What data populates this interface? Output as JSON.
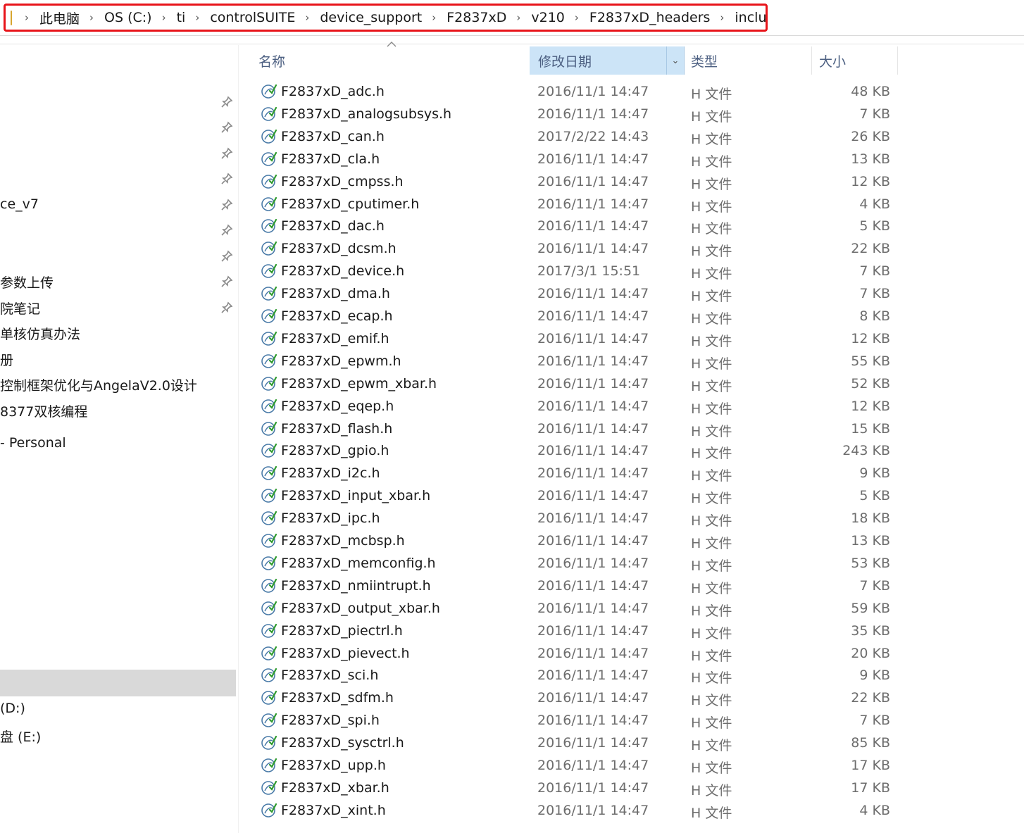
{
  "address_bar": {
    "crumbs": [
      "此电脑",
      "OS (C:)",
      "ti",
      "controlSUITE",
      "device_support",
      "F2837xD",
      "v210",
      "F2837xD_headers",
      "include"
    ],
    "highlight_color": "#e8141a"
  },
  "nav": {
    "items": [
      {
        "label": "ce_v7"
      },
      {
        "label": "参数上传"
      },
      {
        "label": "院笔记"
      },
      {
        "label": "单核仿真办法"
      },
      {
        "label": "册"
      },
      {
        "label": "控制框架优化与AngelaV2.0设计"
      },
      {
        "label": "8377双核编程"
      },
      {
        "label": "- Personal"
      },
      {
        "label": "(D:)"
      },
      {
        "label": "盘 (E:)"
      }
    ]
  },
  "columns": {
    "name": "名称",
    "date": "修改日期",
    "type": "类型",
    "size": "大小"
  },
  "files": [
    {
      "name": "F2837xD_adc.h",
      "date": "2016/11/1 14:47",
      "type": "H 文件",
      "size": "48 KB"
    },
    {
      "name": "F2837xD_analogsubsys.h",
      "date": "2016/11/1 14:47",
      "type": "H 文件",
      "size": "7 KB"
    },
    {
      "name": "F2837xD_can.h",
      "date": "2017/2/22 14:43",
      "type": "H 文件",
      "size": "26 KB"
    },
    {
      "name": "F2837xD_cla.h",
      "date": "2016/11/1 14:47",
      "type": "H 文件",
      "size": "13 KB"
    },
    {
      "name": "F2837xD_cmpss.h",
      "date": "2016/11/1 14:47",
      "type": "H 文件",
      "size": "12 KB"
    },
    {
      "name": "F2837xD_cputimer.h",
      "date": "2016/11/1 14:47",
      "type": "H 文件",
      "size": "4 KB"
    },
    {
      "name": "F2837xD_dac.h",
      "date": "2016/11/1 14:47",
      "type": "H 文件",
      "size": "5 KB"
    },
    {
      "name": "F2837xD_dcsm.h",
      "date": "2016/11/1 14:47",
      "type": "H 文件",
      "size": "22 KB"
    },
    {
      "name": "F2837xD_device.h",
      "date": "2017/3/1 15:51",
      "type": "H 文件",
      "size": "7 KB"
    },
    {
      "name": "F2837xD_dma.h",
      "date": "2016/11/1 14:47",
      "type": "H 文件",
      "size": "7 KB"
    },
    {
      "name": "F2837xD_ecap.h",
      "date": "2016/11/1 14:47",
      "type": "H 文件",
      "size": "8 KB"
    },
    {
      "name": "F2837xD_emif.h",
      "date": "2016/11/1 14:47",
      "type": "H 文件",
      "size": "12 KB"
    },
    {
      "name": "F2837xD_epwm.h",
      "date": "2016/11/1 14:47",
      "type": "H 文件",
      "size": "55 KB"
    },
    {
      "name": "F2837xD_epwm_xbar.h",
      "date": "2016/11/1 14:47",
      "type": "H 文件",
      "size": "52 KB"
    },
    {
      "name": "F2837xD_eqep.h",
      "date": "2016/11/1 14:47",
      "type": "H 文件",
      "size": "12 KB"
    },
    {
      "name": "F2837xD_flash.h",
      "date": "2016/11/1 14:47",
      "type": "H 文件",
      "size": "15 KB"
    },
    {
      "name": "F2837xD_gpio.h",
      "date": "2016/11/1 14:47",
      "type": "H 文件",
      "size": "243 KB"
    },
    {
      "name": "F2837xD_i2c.h",
      "date": "2016/11/1 14:47",
      "type": "H 文件",
      "size": "9 KB"
    },
    {
      "name": "F2837xD_input_xbar.h",
      "date": "2016/11/1 14:47",
      "type": "H 文件",
      "size": "5 KB"
    },
    {
      "name": "F2837xD_ipc.h",
      "date": "2016/11/1 14:47",
      "type": "H 文件",
      "size": "18 KB"
    },
    {
      "name": "F2837xD_mcbsp.h",
      "date": "2016/11/1 14:47",
      "type": "H 文件",
      "size": "13 KB"
    },
    {
      "name": "F2837xD_memconfig.h",
      "date": "2016/11/1 14:47",
      "type": "H 文件",
      "size": "53 KB"
    },
    {
      "name": "F2837xD_nmiintrupt.h",
      "date": "2016/11/1 14:47",
      "type": "H 文件",
      "size": "7 KB"
    },
    {
      "name": "F2837xD_output_xbar.h",
      "date": "2016/11/1 14:47",
      "type": "H 文件",
      "size": "59 KB"
    },
    {
      "name": "F2837xD_piectrl.h",
      "date": "2016/11/1 14:47",
      "type": "H 文件",
      "size": "35 KB"
    },
    {
      "name": "F2837xD_pievect.h",
      "date": "2016/11/1 14:47",
      "type": "H 文件",
      "size": "20 KB"
    },
    {
      "name": "F2837xD_sci.h",
      "date": "2016/11/1 14:47",
      "type": "H 文件",
      "size": "9 KB"
    },
    {
      "name": "F2837xD_sdfm.h",
      "date": "2016/11/1 14:47",
      "type": "H 文件",
      "size": "22 KB"
    },
    {
      "name": "F2837xD_spi.h",
      "date": "2016/11/1 14:47",
      "type": "H 文件",
      "size": "7 KB"
    },
    {
      "name": "F2837xD_sysctrl.h",
      "date": "2016/11/1 14:47",
      "type": "H 文件",
      "size": "85 KB"
    },
    {
      "name": "F2837xD_upp.h",
      "date": "2016/11/1 14:47",
      "type": "H 文件",
      "size": "17 KB"
    },
    {
      "name": "F2837xD_xbar.h",
      "date": "2016/11/1 14:47",
      "type": "H 文件",
      "size": "17 KB"
    },
    {
      "name": "F2837xD_xint.h",
      "date": "2016/11/1 14:47",
      "type": "H 文件",
      "size": "4 KB"
    }
  ]
}
